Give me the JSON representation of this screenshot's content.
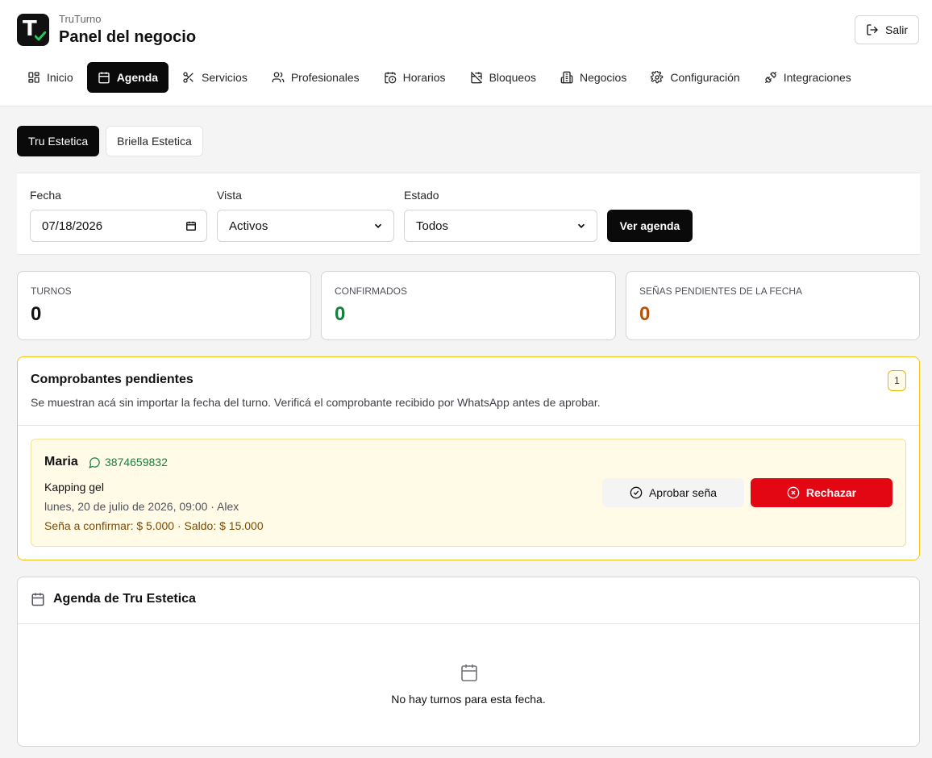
{
  "header": {
    "brand": "TruTurno",
    "title": "Panel del negocio",
    "logout_label": "Salir"
  },
  "nav": {
    "items": [
      {
        "label": "Inicio",
        "icon": "grid-icon"
      },
      {
        "label": "Agenda",
        "icon": "calendar-icon",
        "active": true
      },
      {
        "label": "Servicios",
        "icon": "scissors-icon"
      },
      {
        "label": "Profesionales",
        "icon": "users-icon"
      },
      {
        "label": "Horarios",
        "icon": "calendar-clock-icon"
      },
      {
        "label": "Bloqueos",
        "icon": "calendar-off-icon"
      },
      {
        "label": "Negocios",
        "icon": "building-icon"
      },
      {
        "label": "Configuración",
        "icon": "gear-icon"
      },
      {
        "label": "Integraciones",
        "icon": "plug-icon"
      }
    ]
  },
  "business_tabs": [
    {
      "label": "Tru Estetica",
      "active": true
    },
    {
      "label": "Briella Estetica",
      "active": false
    }
  ],
  "filters": {
    "date_label": "Fecha",
    "date_value": "07/18/2026",
    "view_label": "Vista",
    "view_value": "Activos",
    "status_label": "Estado",
    "status_value": "Todos",
    "submit_label": "Ver agenda"
  },
  "stats": [
    {
      "label": "TURNOS",
      "value": "0",
      "color": "#111111"
    },
    {
      "label": "CONFIRMADOS",
      "value": "0",
      "color": "#15803d"
    },
    {
      "label": "SEÑAS PENDIENTES DE LA FECHA",
      "value": "0",
      "color": "#b45309"
    }
  ],
  "pending": {
    "title": "Comprobantes pendientes",
    "subtitle": "Se muestran acá sin importar la fecha del turno. Verificá el comprobante recibido por WhatsApp antes de aprobar.",
    "count": "1",
    "items": [
      {
        "name": "Maria",
        "phone": "3874659832",
        "service": "Kapping gel",
        "datetime": "lunes, 20 de julio de 2026, 09:00 · Alex",
        "money": "Seña a confirmar: $ 5.000 · Saldo: $ 15.000",
        "approve_label": "Aprobar seña",
        "reject_label": "Rechazar"
      }
    ]
  },
  "agenda": {
    "title": "Agenda de Tru Estetica",
    "empty_text": "No hay turnos para esta fecha."
  },
  "colors": {
    "accent": "#0a0a0a",
    "danger": "#e30613",
    "warning_border": "#f5c518",
    "success": "#15803d"
  }
}
